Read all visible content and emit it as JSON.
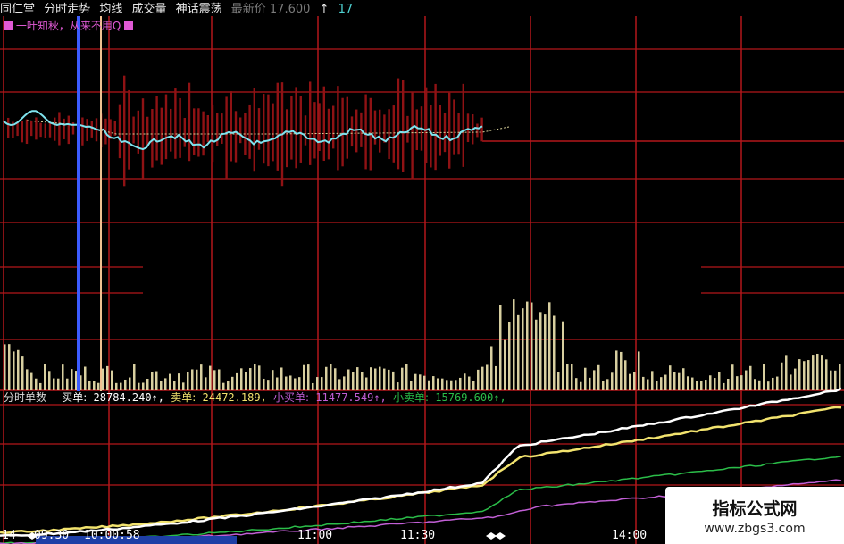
{
  "header": {
    "stock_name": "同仁堂",
    "items": [
      "分时走势",
      "均线",
      "成交量",
      "神话震荡"
    ],
    "price_label": "最新价 17.600",
    "arrow": "↑",
    "right_value": "17"
  },
  "indicator": {
    "text": "一叶知秋，从来不用Q"
  },
  "order_bar": {
    "title": "分时单数",
    "buy_label": "买单:",
    "buy_value": "28784.240↑,",
    "sell_label": "卖单:",
    "sell_value": "24472.189,",
    "small_buy_label": "小买单:",
    "small_buy_value": "11477.549↑,",
    "small_sell_label": "小卖单:",
    "small_sell_value": "15769.600↑,"
  },
  "time_axis": {
    "labels": [
      "14",
      "09:30",
      "10:00:58",
      "11:00",
      "11:30",
      "14:00"
    ]
  },
  "watermark": {
    "brand": "指标公式网",
    "site": "www.zbgs3.com"
  },
  "colors": {
    "grid": "#b3171b",
    "bars": "#8f1214",
    "price_line": "#7fe3ee",
    "avg_line": "#d8d09a",
    "volume": "#d8cfa0",
    "buy": "#ffffff",
    "sell": "#f2e36e",
    "small_buy": "#c25fd6",
    "small_sell": "#2bbd49",
    "cursor_blue": "#3c5cff",
    "cursor_orange": "#f0c090"
  }
}
